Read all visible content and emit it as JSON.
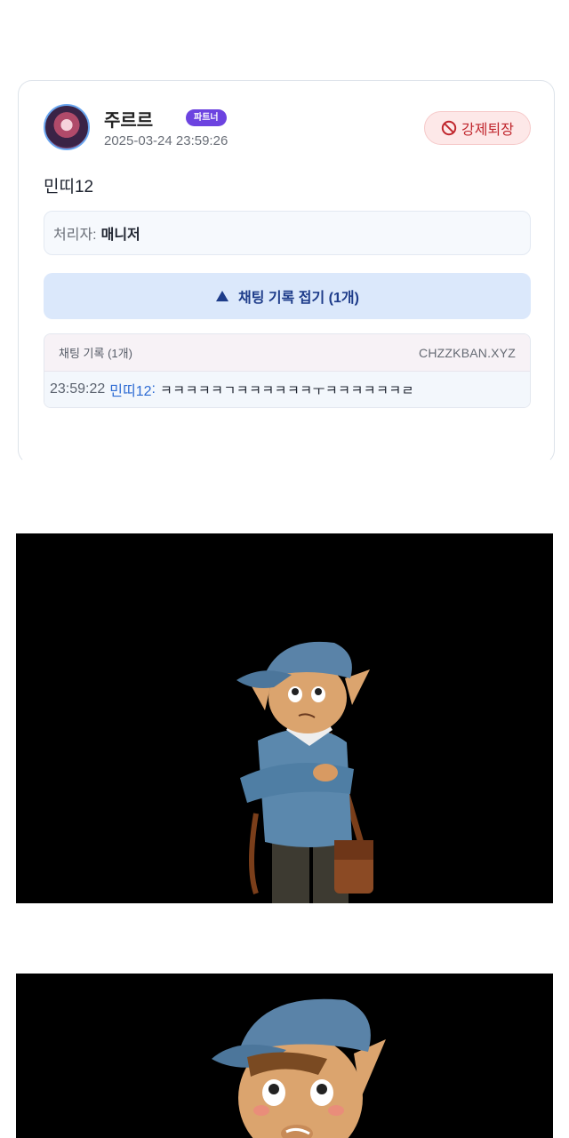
{
  "post": {
    "user_name": "주르르",
    "badge": "파트너",
    "timestamp": "2025-03-24 23:59:26",
    "kick_label": "강제퇴장",
    "target_name": "민띠12",
    "handler_label": "처리자:",
    "handler_value": "매니저",
    "toggle_label": "채팅 기록 접기 (1개)"
  },
  "chat_log": {
    "title": "채팅 기록 (1개)",
    "domain": "CHZZKBAN.XYZ",
    "entries": [
      {
        "time": "23:59:22",
        "user": "민띠12",
        "message": "ㅋㅋㅋㅋㅋㄱㅋㅋㅋㅋㅋㅋㅜㅋㅋㅋㅋㅋㅋㄹ"
      }
    ]
  },
  "colors": {
    "badge": "#6c43e0",
    "kick": "#c0262d",
    "toggle_bg": "#dbe8fb",
    "chat_user": "#2d6bd3",
    "panel_bg": "#000000"
  },
  "icons": {
    "kick": "ban-icon",
    "toggle": "triangle-up-icon"
  }
}
